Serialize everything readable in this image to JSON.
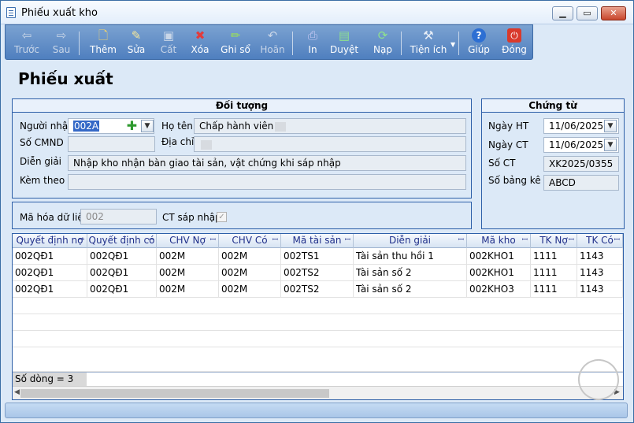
{
  "window": {
    "title": "Phiếu xuất kho"
  },
  "toolbar": {
    "items": [
      {
        "label": "Trước",
        "icon": "arrow-left-icon",
        "enabled": false
      },
      {
        "label": "Sau",
        "icon": "arrow-right-icon",
        "enabled": false
      },
      {
        "label": "Thêm",
        "icon": "add-document-icon",
        "enabled": true
      },
      {
        "label": "Sửa",
        "icon": "edit-icon",
        "enabled": true
      },
      {
        "label": "Cất",
        "icon": "save-icon",
        "enabled": false
      },
      {
        "label": "Xóa",
        "icon": "delete-icon",
        "enabled": true
      },
      {
        "label": "Ghi sổ",
        "icon": "pencil-icon",
        "enabled": true
      },
      {
        "label": "Hoãn",
        "icon": "undo-icon",
        "enabled": false
      },
      {
        "label": "In",
        "icon": "print-icon",
        "enabled": true
      },
      {
        "label": "Duyệt",
        "icon": "approve-icon",
        "enabled": true
      },
      {
        "label": "Nạp",
        "icon": "refresh-icon",
        "enabled": true
      },
      {
        "label": "Tiện ích",
        "icon": "tools-icon",
        "enabled": true
      },
      {
        "label": "Giúp",
        "icon": "help-icon",
        "enabled": true
      },
      {
        "label": "Đóng",
        "icon": "close-power-icon",
        "enabled": true
      }
    ]
  },
  "page": {
    "title": "Phiếu xuất"
  },
  "doi_tuong": {
    "heading": "Đối tượng",
    "nguoi_nhan_label": "Người nhận",
    "nguoi_nhan_value": "002A",
    "ho_ten_label": "Họ tên",
    "ho_ten_value": "Chấp hành viên",
    "so_cmnd_label": "Số CMND",
    "so_cmnd_value": "",
    "dia_chi_label": "Địa chỉ",
    "dia_chi_value": "",
    "dien_giai_label": "Diễn giải",
    "dien_giai_value": "Nhập kho nhận bàn giao tài sản, vật chứng khi sáp nhập",
    "kem_theo_label": "Kèm theo",
    "kem_theo_value": ""
  },
  "ma_hoa": {
    "label": "Mã hóa dữ liệu",
    "value": "002",
    "ct_sap_nhap_label": "CT sáp nhập",
    "ct_sap_nhap_checked": true
  },
  "chung_tu": {
    "heading": "Chứng từ",
    "ngay_ht_label": "Ngày HT",
    "ngay_ht_value": "11/06/2025",
    "ngay_ct_label": "Ngày CT",
    "ngay_ct_value": "11/06/2025",
    "so_ct_label": "Số CT",
    "so_ct_value": "XK2025/0355",
    "so_bang_ke_label": "Số bảng kê",
    "so_bang_ke_value": "ABCD"
  },
  "grid": {
    "columns": [
      "Quyết định nợ",
      "Quyết định có",
      "CHV Nợ",
      "CHV Có",
      "Mã tài sản",
      "Diễn giải",
      "Mã kho",
      "TK Nợ",
      "TK Có"
    ],
    "rows": [
      [
        "002QĐ1",
        "002QĐ1",
        "002M",
        "002M",
        "002TS1",
        "Tài sản thu hồi 1",
        "002KHO1",
        "1111",
        "1143"
      ],
      [
        "002QĐ1",
        "002QĐ1",
        "002M",
        "002M",
        "002TS2",
        "Tài sản số 2",
        "002KHO1",
        "1111",
        "1143"
      ],
      [
        "002QĐ1",
        "002QĐ1",
        "002M",
        "002M",
        "002TS2",
        "Tài sản số 2",
        "002KHO3",
        "1111",
        "1143"
      ]
    ],
    "row_count_text": "Số dòng = 3"
  }
}
